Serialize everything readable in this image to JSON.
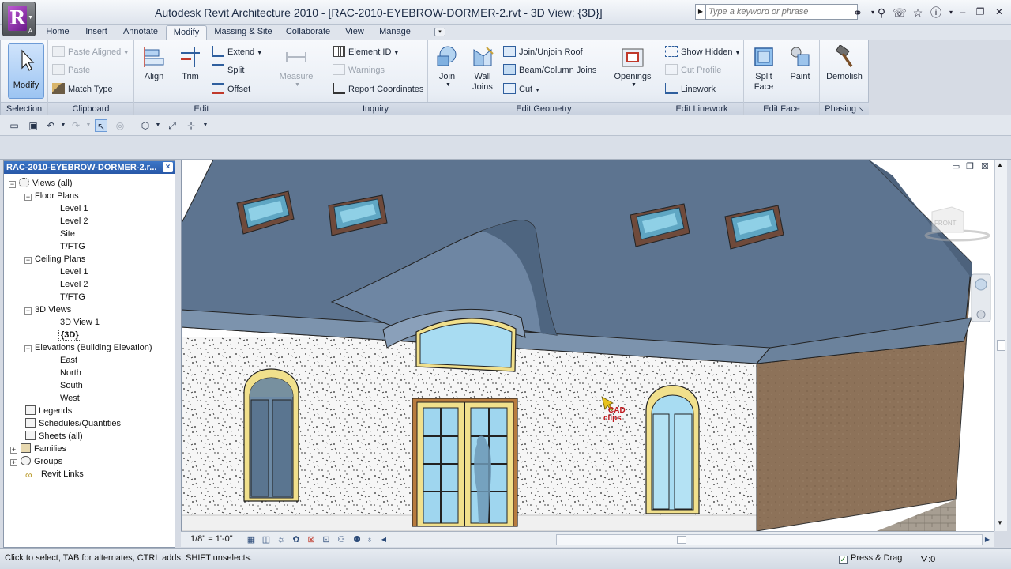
{
  "window": {
    "title": "Autodesk Revit Architecture 2010 - [RAC-2010-EYEBROW-DORMER-2.rvt - 3D View: {3D}]",
    "app_letter": "R",
    "app_sub": "A"
  },
  "search": {
    "placeholder": "Type a keyword or phrase"
  },
  "tabs": [
    "Home",
    "Insert",
    "Annotate",
    "Modify",
    "Massing & Site",
    "Collaborate",
    "View",
    "Manage"
  ],
  "active_tab": "Modify",
  "ribbon": {
    "selection": {
      "label": "Selection",
      "modify": "Modify"
    },
    "clipboard": {
      "label": "Clipboard",
      "paste_aligned": "Paste Aligned",
      "paste": "Paste",
      "match_type": "Match Type"
    },
    "edit": {
      "label": "Edit",
      "align": "Align",
      "trim": "Trim",
      "extend": "Extend",
      "split": "Split",
      "offset": "Offset"
    },
    "measure": "Measure",
    "inquiry": {
      "label": "Inquiry",
      "element_id": "Element ID",
      "warnings": "Warnings",
      "report_coordinates": "Report Coordinates"
    },
    "edit_geometry": {
      "label": "Edit Geometry",
      "join": "Join",
      "wall": "Wall",
      "joins": "Joins",
      "join_unjoin_roof": "Join/Unjoin Roof",
      "beam_column_joins": "Beam/Column Joins",
      "cut": "Cut",
      "openings": "Openings"
    },
    "edit_linework": {
      "label": "Edit Linework",
      "show_hidden": "Show Hidden",
      "cut_profile": "Cut Profile",
      "linework": "Linework"
    },
    "edit_face": {
      "label": "Edit Face",
      "split": "Split",
      "face": "Face",
      "paint": "Paint"
    },
    "phasing": {
      "label": "Phasing",
      "demolish": "Demolish"
    }
  },
  "browser": {
    "title": "RAC-2010-EYEBROW-DORMER-2.r...",
    "close": "×",
    "views_all": "Views (all)",
    "floor_plans": "Floor Plans",
    "floor_plan_items": [
      "Level 1",
      "Level 2",
      "Site",
      "T/FTG"
    ],
    "ceiling_plans": "Ceiling Plans",
    "ceiling_plan_items": [
      "Level 1",
      "Level 2",
      "T/FTG"
    ],
    "views_3d": "3D Views",
    "views_3d_items": [
      "3D View 1",
      "{3D}"
    ],
    "elevations": "Elevations (Building Elevation)",
    "elevation_items": [
      "East",
      "North",
      "South",
      "West"
    ],
    "legends": "Legends",
    "schedules": "Schedules/Quantities",
    "sheets": "Sheets (all)",
    "families": "Families",
    "groups": "Groups",
    "revit_links": "Revit Links"
  },
  "viewport": {
    "annotation": "CAD clips",
    "annotation_line1": "CAD",
    "annotation_line2": "clips",
    "viewcube_face": "FRONT",
    "scale": "1/8\" = 1'-0\"",
    "colors": {
      "roof": "#5d7490",
      "wall": "#f4f4f4",
      "brick": "#8a6e55",
      "glass": "#9fd6ef",
      "door_frame": "#f1e08c"
    }
  },
  "status": {
    "hint": "Click to select, TAB for alternates, CTRL adds, SHIFT unselects.",
    "press_drag": "Press & Drag",
    "filter_count": ":0"
  }
}
